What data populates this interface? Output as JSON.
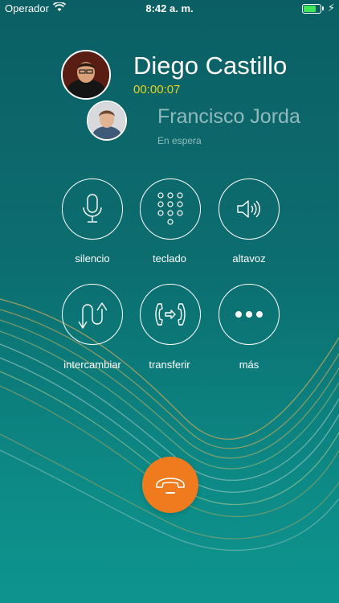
{
  "status_bar": {
    "carrier": "Operador",
    "time": "8:42 a. m.",
    "battery_level": 0.85,
    "charging": true
  },
  "call": {
    "active": {
      "name": "Diego Castillo",
      "duration": "00:00:07"
    },
    "held": {
      "name": "Francisco Jorda",
      "status": "En espera"
    }
  },
  "controls": {
    "mute": "silencio",
    "keypad": "teclado",
    "speaker": "altavoz",
    "swap": "intercambiar",
    "transfer": "transferir",
    "more": "más"
  },
  "colors": {
    "accent_timer": "#e3d31f",
    "end_call": "#f07a1e",
    "background": "#0c6e70"
  }
}
